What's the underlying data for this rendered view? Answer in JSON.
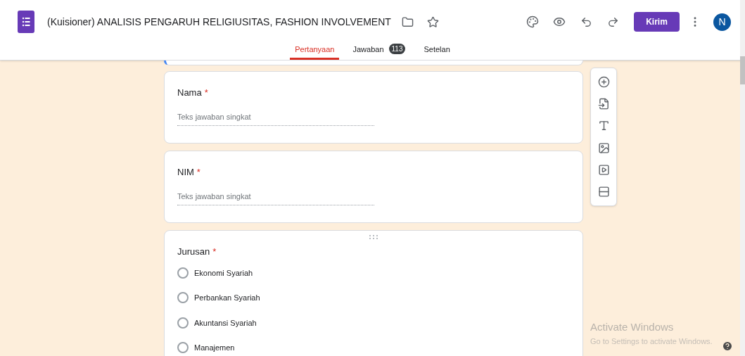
{
  "header": {
    "title": "(Kuisioner) ANALISIS PENGARUH RELIGIUSITAS, FASHION INVOLVEMENT",
    "send_button": "Kirim",
    "avatar": "N"
  },
  "tabs": [
    {
      "label": "Pertanyaan",
      "selected": true
    },
    {
      "label": "Jawaban",
      "selected": false,
      "badge": "113"
    },
    {
      "label": "Setelan",
      "selected": false
    }
  ],
  "questions": [
    {
      "kind": "short",
      "title": "Nama",
      "required_mark": "*",
      "placeholder": "Teks jawaban singkat"
    },
    {
      "kind": "short",
      "title": "NIM",
      "required_mark": "*",
      "placeholder": "Teks jawaban singkat"
    },
    {
      "kind": "choice",
      "title": "Jurusan",
      "required_mark": "*",
      "options": [
        {
          "label": "Ekonomi Syariah",
          "selected": false
        },
        {
          "label": "Perbankan Syariah",
          "selected": false
        },
        {
          "label": "Akuntansi Syariah",
          "selected": false
        },
        {
          "label": "Manajemen",
          "selected": false
        }
      ]
    }
  ],
  "overlay": {
    "title": "Activate Windows",
    "subtitle": "Go to Settings to activate Windows."
  }
}
